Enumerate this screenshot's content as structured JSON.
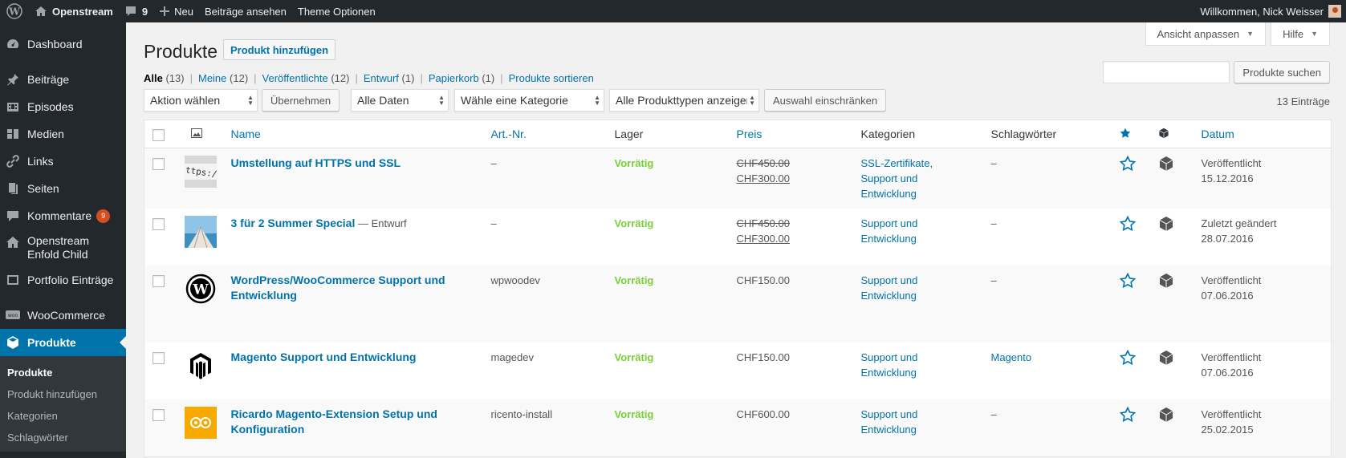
{
  "adminbar": {
    "site_name": "Openstream",
    "comments_count": "9",
    "new_label": "Neu",
    "view_posts": "Beiträge ansehen",
    "theme_options": "Theme Optionen",
    "greeting": "Willkommen, Nick Weisser"
  },
  "sidebar": {
    "items": [
      {
        "label": "Dashboard",
        "icon": "dashboard-icon"
      },
      {
        "label": "Beiträge",
        "icon": "pin-icon"
      },
      {
        "label": "Episodes",
        "icon": "film-icon"
      },
      {
        "label": "Medien",
        "icon": "media-icon"
      },
      {
        "label": "Links",
        "icon": "link-icon"
      },
      {
        "label": "Seiten",
        "icon": "pages-icon"
      },
      {
        "label": "Kommentare",
        "icon": "comment-icon",
        "badge": "9"
      },
      {
        "label": "Openstream Enfold Child",
        "icon": "home-icon"
      },
      {
        "label": "Portfolio Einträge",
        "icon": "portfolio-icon"
      },
      {
        "label": "WooCommerce",
        "icon": "woocommerce-icon"
      },
      {
        "label": "Produkte",
        "icon": "product-icon"
      }
    ],
    "submenu": [
      "Produkte",
      "Produkt hinzufügen",
      "Kategorien",
      "Schlagwörter"
    ]
  },
  "screen_options": {
    "label": "Ansicht anpassen",
    "help": "Hilfe"
  },
  "page": {
    "title": "Produkte",
    "add_new": "Produkt hinzufügen"
  },
  "views": [
    {
      "label": "Alle",
      "count": "(13)"
    },
    {
      "label": "Meine",
      "count": "(12)"
    },
    {
      "label": "Veröffentlichte",
      "count": "(12)"
    },
    {
      "label": "Entwurf",
      "count": "(1)"
    },
    {
      "label": "Papierkorb",
      "count": "(1)"
    },
    {
      "label": "Produkte sortieren",
      "count": ""
    }
  ],
  "search": {
    "button": "Produkte suchen",
    "placeholder": ""
  },
  "filters": {
    "bulk_action": "Aktion wählen",
    "apply": "Übernehmen",
    "dates": "Alle Daten",
    "category": "Wähle eine Kategorie",
    "product_type": "Alle Produkttypen anzeigen",
    "filter_button": "Auswahl einschränken",
    "items_count": "13 Einträge"
  },
  "columns": {
    "name": "Name",
    "sku": "Art.-Nr.",
    "stock": "Lager",
    "price": "Preis",
    "categories": "Kategorien",
    "tags": "Schlagwörter",
    "date": "Datum"
  },
  "rows": [
    {
      "thumb": "https-thumbnail",
      "name": "Umstellung auf HTTPS und SSL",
      "state": "",
      "sku": "–",
      "stock": "Vorrätig",
      "price_old": "CHF450.00",
      "price": "CHF300.00",
      "categories": [
        "SSL-Zertifikate,",
        "Support und Entwicklung"
      ],
      "tags": "–",
      "tags_link": false,
      "date_status": "Veröffentlicht",
      "date": "15.12.2016"
    },
    {
      "thumb": "pier-thumbnail",
      "name": "3 für 2 Summer Special",
      "state": " — Entwurf",
      "sku": "–",
      "stock": "Vorrätig",
      "price_old": "CHF450.00",
      "price": "CHF300.00",
      "categories": [
        "Support und Entwicklung"
      ],
      "tags": "–",
      "tags_link": false,
      "date_status": "Zuletzt geändert",
      "date": "28.07.2016"
    },
    {
      "thumb": "wordpress-logo-thumbnail",
      "name": "WordPress/WooCommerce Support und Entwicklung",
      "state": "",
      "sku": "wpwoodev",
      "stock": "Vorrätig",
      "price_old": "",
      "price": "CHF150.00",
      "categories": [
        "Support und Entwicklung"
      ],
      "tags": "–",
      "tags_link": false,
      "date_status": "Veröffentlicht",
      "date": "07.06.2016"
    },
    {
      "thumb": "magento-logo-thumbnail",
      "name": "Magento Support und Entwicklung",
      "state": "",
      "sku": "magedev",
      "stock": "Vorrätig",
      "price_old": "",
      "price": "CHF150.00",
      "categories": [
        "Support und Entwicklung"
      ],
      "tags": "Magento",
      "tags_link": true,
      "date_status": "Veröffentlicht",
      "date": "07.06.2016"
    },
    {
      "thumb": "ricardo-logo-thumbnail",
      "name": "Ricardo Magento-Extension Setup und Konfiguration",
      "state": "",
      "sku": "ricento-install",
      "stock": "Vorrätig",
      "price_old": "",
      "price": "CHF600.00",
      "categories": [
        "Support und Entwicklung"
      ],
      "tags": "–",
      "tags_link": false,
      "date_status": "Veröffentlicht",
      "date": "25.02.2015"
    }
  ],
  "colors": {
    "accent": "#0073aa",
    "sidebar": "#23282d",
    "in_stock": "#7ad03a",
    "badge": "#d54e21"
  }
}
